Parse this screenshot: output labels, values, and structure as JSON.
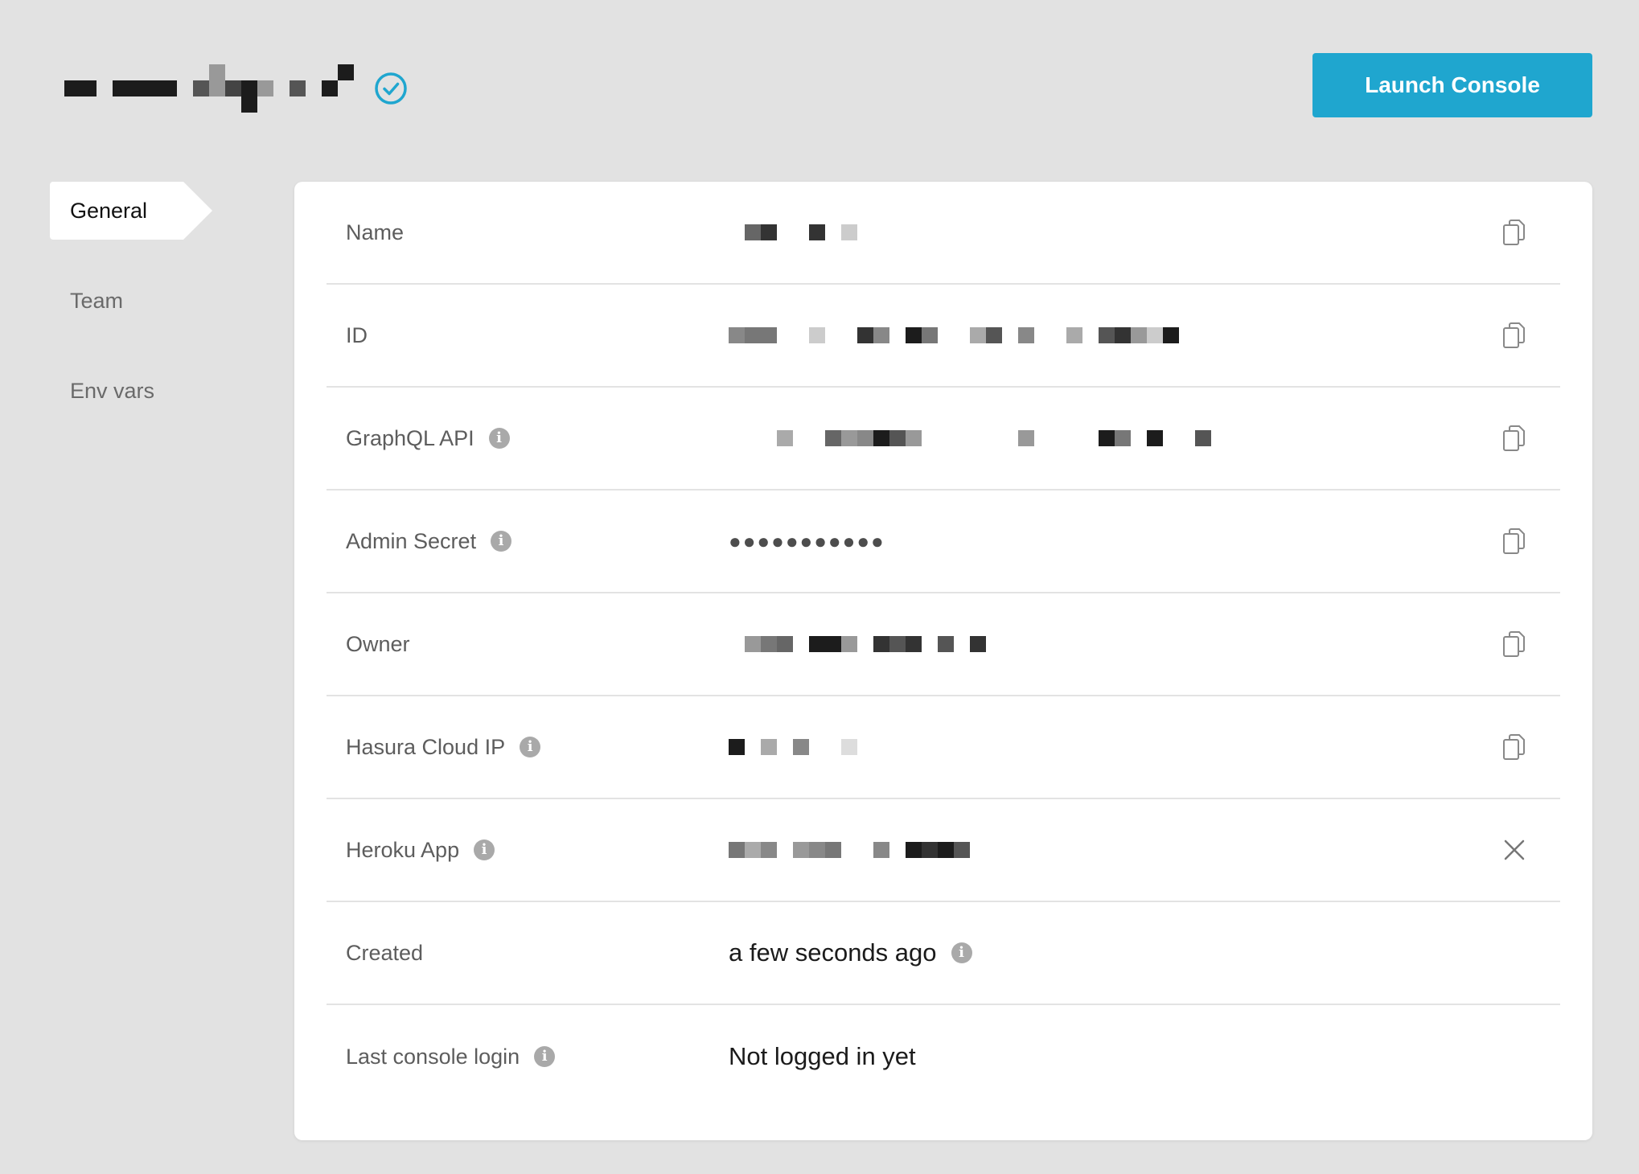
{
  "header": {
    "launch_label": "Launch Console"
  },
  "sidebar": {
    "items": [
      {
        "label": "General"
      },
      {
        "label": "Team"
      },
      {
        "label": "Env vars"
      }
    ]
  },
  "details": {
    "rows": [
      {
        "label": "Name"
      },
      {
        "label": "ID"
      },
      {
        "label": "GraphQL API"
      },
      {
        "label": "Admin Secret",
        "value": "●●●●●●●●●●●"
      },
      {
        "label": "Owner"
      },
      {
        "label": "Hasura Cloud IP"
      },
      {
        "label": "Heroku App"
      },
      {
        "label": "Created",
        "value": "a few seconds ago"
      },
      {
        "label": "Last console login",
        "value": "Not logged in yet"
      }
    ]
  },
  "colors": {
    "accent": "#1fa6cf",
    "background": "#e2e2e2",
    "card": "#ffffff"
  },
  "icons": {
    "verified": "check-circle-icon",
    "info": "info-icon",
    "copy": "copy-icon",
    "remove": "close-icon"
  }
}
